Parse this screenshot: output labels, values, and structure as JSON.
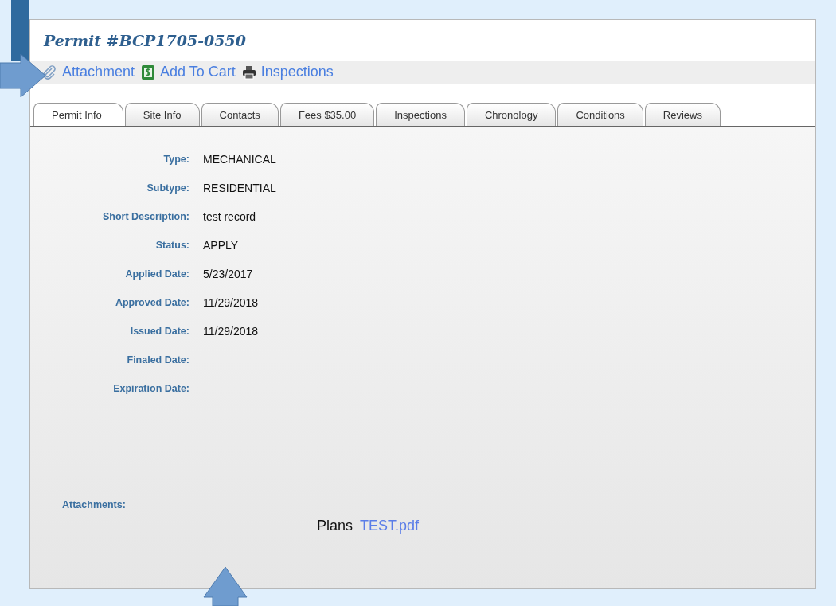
{
  "title": "Permit #BCP1705-0550",
  "toolbar": [
    {
      "label": "Attachment",
      "kind": "clip"
    },
    {
      "label": "Add To Cart",
      "kind": "cart"
    },
    {
      "label": "Inspections",
      "kind": "print"
    }
  ],
  "tabs": [
    {
      "label": "Permit Info",
      "selected": true
    },
    {
      "label": "Site Info",
      "selected": false
    },
    {
      "label": "Contacts",
      "selected": false
    },
    {
      "label": "Fees $35.00",
      "selected": false
    },
    {
      "label": "Inspections",
      "selected": false
    },
    {
      "label": "Chronology",
      "selected": false
    },
    {
      "label": "Conditions",
      "selected": false
    },
    {
      "label": "Reviews",
      "selected": false
    }
  ],
  "fields": [
    {
      "label": "Type:",
      "value": "MECHANICAL"
    },
    {
      "label": "Subtype:",
      "value": "RESIDENTIAL"
    },
    {
      "label": "Short Description:",
      "value": "test record"
    },
    {
      "label": "Status:",
      "value": "APPLY"
    },
    {
      "label": "Applied Date:",
      "value": "5/23/2017"
    },
    {
      "label": "Approved Date:",
      "value": "11/29/2018"
    },
    {
      "label": "Issued Date:",
      "value": "11/29/2018"
    },
    {
      "label": "Finaled Date:"
    },
    {
      "label": "Expiration Date:"
    }
  ],
  "attachments": {
    "label": "Attachments:",
    "items": [
      {
        "name": "Plans",
        "file": "TEST.pdf"
      }
    ]
  }
}
